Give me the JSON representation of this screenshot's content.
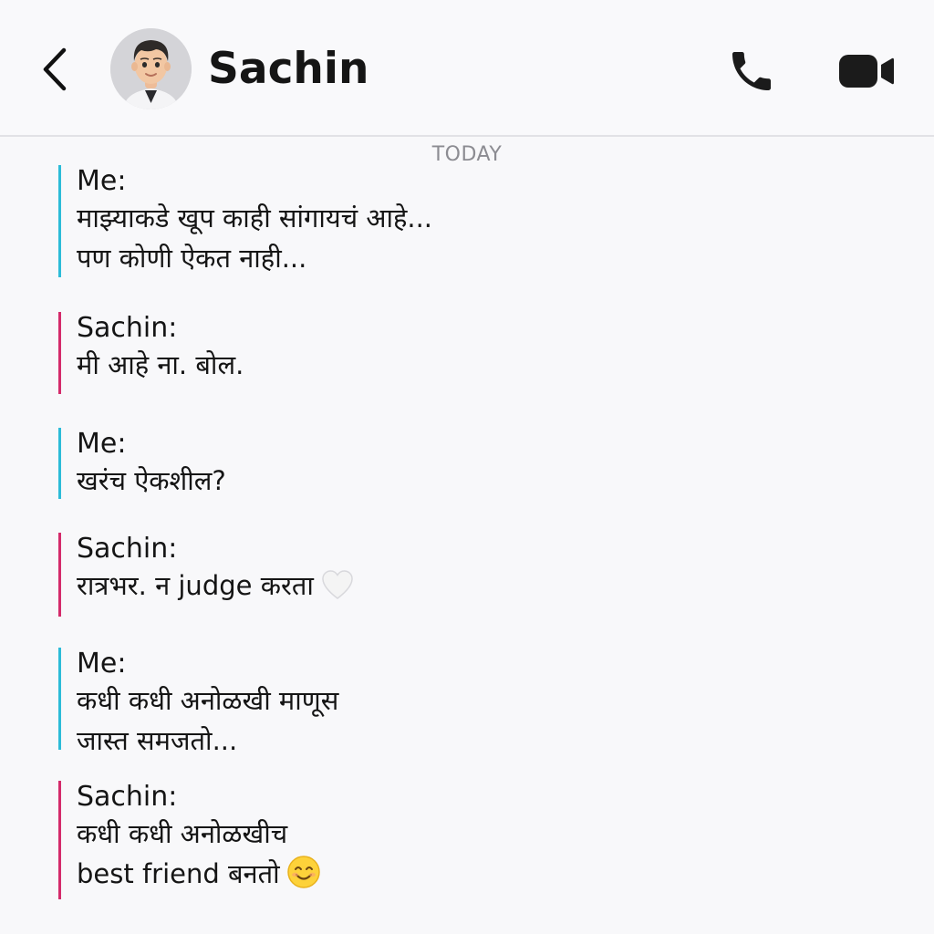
{
  "header": {
    "back_icon": "chevron-left-icon",
    "contact_name": "Sachin",
    "avatar": "avatar-memoji",
    "call_icon": "phone-icon",
    "video_icon": "video-camera-icon"
  },
  "chat": {
    "date_label": "TODAY",
    "messages": [
      {
        "sender": "Me:",
        "lines": [
          "माझ्याकडे खूप काही सांगायचं आहे...",
          "पण कोणी ऐकत नाही..."
        ]
      },
      {
        "sender": "Sachin:",
        "lines": [
          "मी आहे ना. बोल."
        ]
      },
      {
        "sender": "Me:",
        "lines": [
          "खरंच ऐकशील?"
        ]
      },
      {
        "sender": "Sachin:",
        "lines": [
          "रात्रभर. न judge करता"
        ],
        "emoji": "white-heart-icon"
      },
      {
        "sender": "Me:",
        "lines": [
          "कधी कधी अनोळखी माणूस",
          "जास्त समजतो..."
        ]
      },
      {
        "sender": "Sachin:",
        "lines": [
          "कधी कधी अनोळखीच",
          "best friend बनतो"
        ],
        "emoji": "smiling-face-icon"
      }
    ]
  },
  "colors": {
    "me_accent": "#2cbcd8",
    "them_accent": "#d42a6a",
    "background": "#f8f8fa"
  }
}
